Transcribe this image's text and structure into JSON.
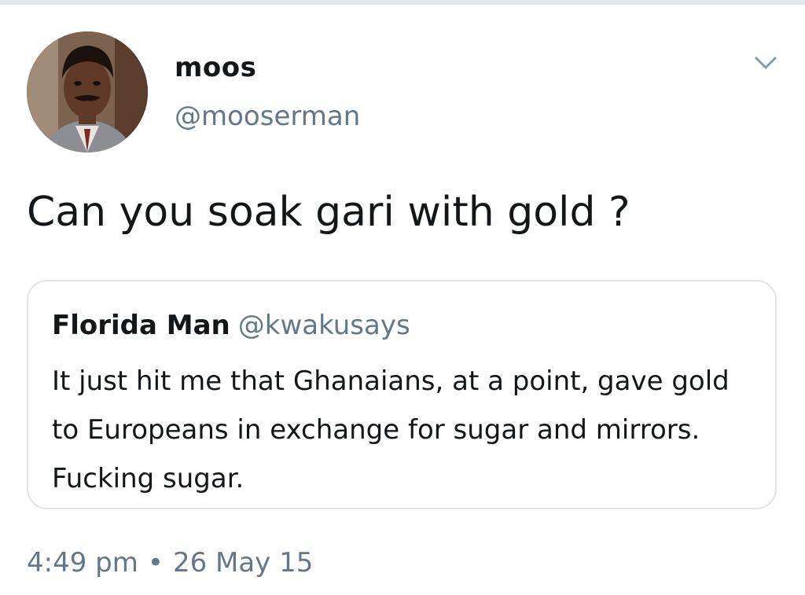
{
  "tweet": {
    "author": {
      "name": "moos",
      "handle": "@mooserman",
      "avatar_icon": "profile-photo"
    },
    "text": "Can you soak gari with gold ?",
    "more_icon": "chevron-down-icon",
    "quoted": {
      "name": "Florida Man",
      "handle": "@kwakusays",
      "text": "It just hit me that Ghanaians, at a point, gave gold to Europeans in exchange for sugar and mirrors. Fucking sugar."
    },
    "time": "4:49 pm",
    "separator": "•",
    "date": "26 May 15"
  },
  "colors": {
    "text_primary": "#14171a",
    "text_secondary": "#657786",
    "border": "#dfe5ea"
  }
}
